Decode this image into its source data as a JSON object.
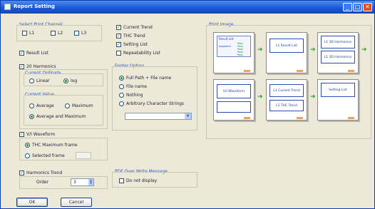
{
  "window": {
    "title": "Report Setting",
    "close_glyph": "✕",
    "min_glyph": "_",
    "max_glyph": "□"
  },
  "print_channel": {
    "label": "Select Print Channel",
    "channels": [
      "L1",
      "L2",
      "L3"
    ]
  },
  "result_list": "Result List",
  "harmonics": {
    "label": "20 Harmonics",
    "ordinate_label": "Current Ordinate",
    "ordinate_options": [
      "Linear",
      "log"
    ],
    "value_label": "Current Value",
    "value_options": [
      "Average",
      "Maximum",
      "Average and Maximum"
    ]
  },
  "waveform": {
    "label": "V/I Waveform",
    "options": [
      "THC Maximum frame",
      "Selected frame"
    ]
  },
  "harmonic_trend": {
    "label": "Harmonics Trend",
    "order_label": "Order",
    "order_value": "3"
  },
  "buttons": {
    "ok": "OK",
    "cancel": "Cancel"
  },
  "lists": [
    "Current Trend",
    "THC Trend",
    "Setting List",
    "Repeatability List"
  ],
  "footer": {
    "label": "Footer Option",
    "options": [
      "Full Path + File name",
      "File name",
      "Nothing",
      "Arbitrary Character Strings"
    ],
    "dropdown_value": ""
  },
  "overwrite": {
    "label": "PDF Over Write Message",
    "checkbox": "Do not display"
  },
  "print_image": {
    "label": "Print Image",
    "panels": [
      {
        "lines": [
          "Result List"
        ]
      },
      {
        "lines": [
          "L1 Result List"
        ]
      },
      {
        "lines": [
          "L1 3D Harmonics",
          "L1 3D Harmonics"
        ]
      },
      {
        "lines": [
          "V/I Waveform"
        ]
      },
      {
        "lines": [
          "L1 Current Trend",
          "L1 THC Trend"
        ]
      },
      {
        "lines": [
          "Setting List"
        ]
      }
    ],
    "first_panel_rows": [
      "Pass",
      "Pass",
      "Pass",
      "Pass",
      "Pass"
    ],
    "first_panel_caption": "Judgment"
  },
  "icons": {
    "window": "report-window-icon",
    "arrow": "next-arrow-icon",
    "dropdown": "chevron-down-icon",
    "spin": "spin-arrows-icon"
  },
  "colors": {
    "titlebar": "#1b5ad8",
    "dialog": "#ece9d8",
    "group_label": "#2a55c8",
    "arrow": "#2a9c2a",
    "close": "#d8502c"
  }
}
